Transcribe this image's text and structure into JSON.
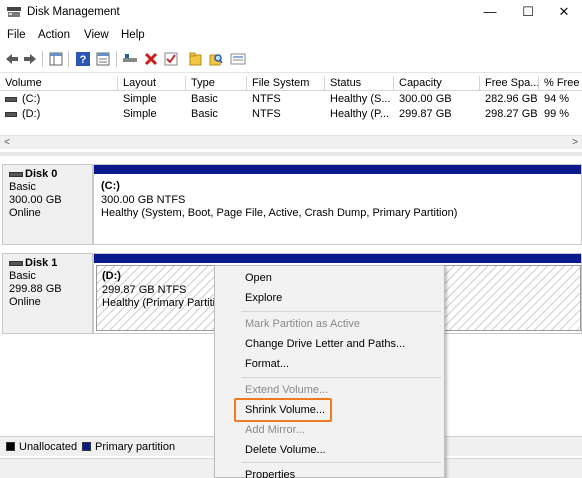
{
  "window": {
    "title": "Disk Management",
    "minimize_glyph": "—",
    "maximize_glyph": "☐",
    "close_glyph": "✕"
  },
  "menu": [
    "File",
    "Action",
    "View",
    "Help"
  ],
  "toolbar_icons": [
    "back-arrow-icon",
    "forward-arrow-icon",
    "console-tree-icon",
    "help-icon",
    "properties-icon",
    "connect-icon",
    "delete-icon",
    "check-icon",
    "folder-icon",
    "search-icon",
    "list-view-icon"
  ],
  "volume_list": {
    "columns": [
      "Volume",
      "Layout",
      "Type",
      "File System",
      "Status",
      "Capacity",
      "Free Spa...",
      "% Free"
    ],
    "rows": [
      {
        "volume": "(C:)",
        "layout": "Simple",
        "type": "Basic",
        "fs": "NTFS",
        "status": "Healthy (S...",
        "capacity": "300.00 GB",
        "free": "282.96 GB",
        "pct": "94 %"
      },
      {
        "volume": "(D:)",
        "layout": "Simple",
        "type": "Basic",
        "fs": "NTFS",
        "status": "Healthy (P...",
        "capacity": "299.87 GB",
        "free": "298.27 GB",
        "pct": "99 %"
      }
    ]
  },
  "disks": [
    {
      "name": "Disk 0",
      "type": "Basic",
      "size": "300.00 GB",
      "state": "Online",
      "partition": {
        "label": "(C:)",
        "size_fs": "300.00 GB NTFS",
        "status": "Healthy (System, Boot, Page File, Active, Crash Dump, Primary Partition)"
      }
    },
    {
      "name": "Disk 1",
      "type": "Basic",
      "size": "299.88 GB",
      "state": "Online",
      "partition": {
        "label": "(D:)",
        "size_fs": "299.87 GB NTFS",
        "status": "Healthy (Primary Partiti"
      }
    }
  ],
  "legend": {
    "unallocated": {
      "label": "Unallocated",
      "color": "#000000"
    },
    "primary": {
      "label": "Primary partition",
      "color": "#0a1a8c"
    }
  },
  "context_menu": {
    "open": "Open",
    "explore": "Explore",
    "mark_active": "Mark Partition as Active",
    "change_letter": "Change Drive Letter and Paths...",
    "format": "Format...",
    "extend": "Extend Volume...",
    "shrink": "Shrink Volume...",
    "add_mirror": "Add Mirror...",
    "delete": "Delete Volume...",
    "properties": "Properties"
  },
  "colors": {
    "accent_highlight": "#f07a20",
    "partition_bar": "#0a1a8c"
  }
}
